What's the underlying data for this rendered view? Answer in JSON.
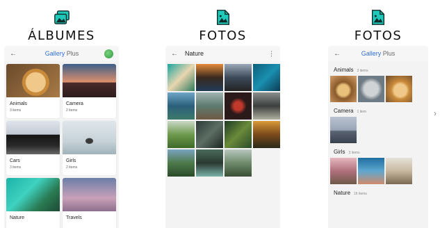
{
  "panels": [
    {
      "title": "ÁLBUMES",
      "app_title_brand": "Gallery",
      "app_title_plus": "Plus"
    },
    {
      "title": "FOTOS",
      "app_title": "Nature"
    },
    {
      "title": "FOTOS",
      "app_title_brand": "Gallery",
      "app_title_plus": "Plus"
    }
  ],
  "albums": [
    {
      "name": "Animals",
      "count": "3 items"
    },
    {
      "name": "Camera",
      "count": "2 items"
    },
    {
      "name": "Cars",
      "count": "3 items"
    },
    {
      "name": "Girls",
      "count": "2 items"
    },
    {
      "name": "Nature",
      "count": ""
    },
    {
      "name": "Travels",
      "count": ""
    }
  ],
  "sections": [
    {
      "name": "Animals",
      "count": "3 items"
    },
    {
      "name": "Camera",
      "count": "1 item"
    },
    {
      "name": "Girls",
      "count": "3 items"
    },
    {
      "name": "Nature",
      "count": "16 items"
    }
  ],
  "icons": {
    "header": "image-file-icon",
    "back": "arrow-left-icon",
    "more": "more-vert-icon",
    "next": "chevron-right-icon"
  },
  "colors": {
    "accent": "#2d6fd3",
    "icon_teal": "#1fc9b9"
  }
}
